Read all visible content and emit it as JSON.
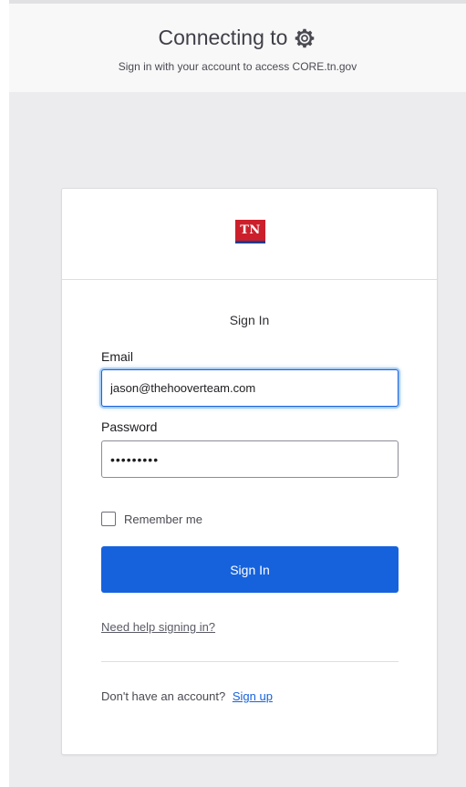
{
  "header": {
    "title": "Connecting to",
    "subtitle": "Sign in with your account to access CORE.tn.gov",
    "icon": "gear-icon"
  },
  "logo": {
    "text": "TN",
    "brand_color": "#cc1f2c",
    "underline_color": "#1d3f8f"
  },
  "form": {
    "title": "Sign In",
    "email_label": "Email",
    "email_value": "jason@thehooverteam.com",
    "password_label": "Password",
    "password_value": "•••••••••",
    "remember_label": "Remember me",
    "remember_checked": false,
    "submit_label": "Sign In",
    "help_link": "Need help signing in?",
    "signup_prompt": "Don't have an account?",
    "signup_link": "Sign up"
  },
  "colors": {
    "accent": "#1662dd",
    "page_bg": "#ececef"
  }
}
